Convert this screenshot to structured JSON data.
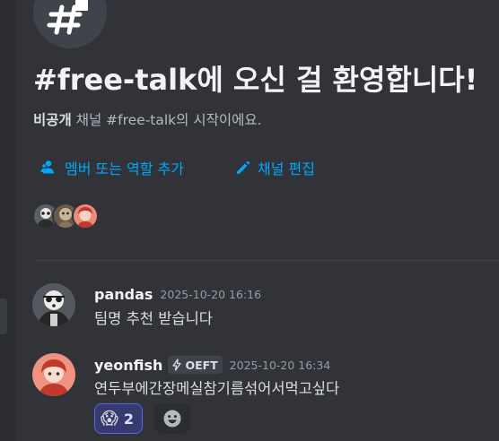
{
  "channel": {
    "welcome_title": "#free-talk에 오신 걸 환영합니다!",
    "subtitle_strong": "비공개",
    "subtitle_rest": " 채널 #free-talk의 시작이에요."
  },
  "actions": {
    "add_member_label": "멤버 또는 역할 추가",
    "edit_channel_label": "채널 편집"
  },
  "messages": [
    {
      "username": "pandas",
      "timestamp": "2025-10-20 16:16",
      "text": "팀명 추천 받습니다"
    },
    {
      "username": "yeonfish",
      "tag": "OEFT",
      "timestamp": "2025-10-20 16:34",
      "text": "연두부에간장메실참기름섞어서먹고싶다",
      "reaction": {
        "emoji": "😱",
        "count": "2"
      }
    }
  ],
  "icons": {
    "channel": "hash-icon",
    "add_member": "person-add-icon",
    "edit": "pencil-icon",
    "tag": "lightning-icon",
    "add_reaction": "smile-icon"
  },
  "colors": {
    "background": "#313338",
    "link": "#00a8fc",
    "reaction_border": "#5865f2"
  }
}
